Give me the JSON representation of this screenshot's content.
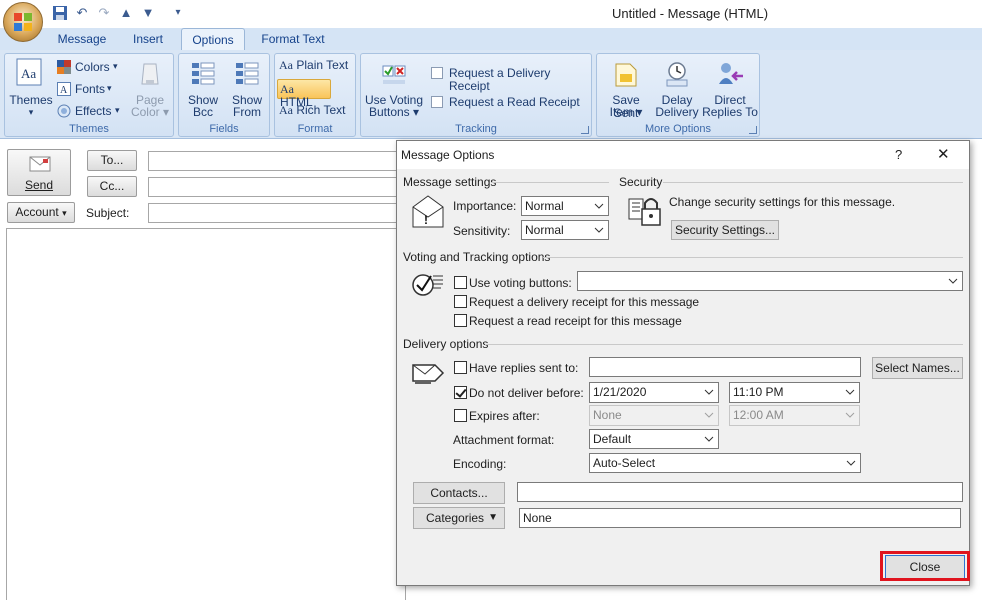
{
  "window": {
    "title": "Untitled - Message (HTML)"
  },
  "ribbon": {
    "tabs": [
      {
        "label": "Message"
      },
      {
        "label": "Insert"
      },
      {
        "label": "Options"
      },
      {
        "label": "Format Text"
      }
    ],
    "active_tab": "Options",
    "groups": {
      "themes": {
        "label": "Themes",
        "themes_button": "Themes",
        "colors": "Colors",
        "fonts": "Fonts",
        "effects": "Effects",
        "page_color_line1": "Page",
        "page_color_line2": "Color"
      },
      "fields": {
        "label": "Fields",
        "show_bcc_line1": "Show",
        "show_bcc_line2": "Bcc",
        "show_from_line1": "Show",
        "show_from_line2": "From"
      },
      "format": {
        "label": "Format",
        "plain_text": "Plain Text",
        "html": "HTML",
        "rich_text": "Rich Text"
      },
      "tracking": {
        "label": "Tracking",
        "voting_line1": "Use Voting",
        "voting_line2": "Buttons",
        "delivery_receipt": "Request a Delivery Receipt",
        "read_receipt": "Request a Read Receipt"
      },
      "more_options": {
        "label": "More Options",
        "save_sent_line1": "Save Sent",
        "save_sent_line2": "Item",
        "delay_line1": "Delay",
        "delay_line2": "Delivery",
        "direct_line1": "Direct",
        "direct_line2": "Replies To"
      }
    }
  },
  "compose": {
    "send": "Send",
    "to": "To...",
    "cc": "Cc...",
    "account": "Account",
    "subject_label": "Subject:"
  },
  "dialog": {
    "title": "Message Options",
    "help": "?",
    "close_x": "✕",
    "message_settings": {
      "heading": "Message settings",
      "importance_label": "Importance:",
      "importance_value": "Normal",
      "sensitivity_label": "Sensitivity:",
      "sensitivity_value": "Normal"
    },
    "security": {
      "heading": "Security",
      "description": "Change security settings for this message.",
      "button": "Security Settings..."
    },
    "voting": {
      "heading": "Voting and Tracking options",
      "use_voting": "Use voting buttons:",
      "use_voting_checked": false,
      "delivery_receipt": "Request a delivery receipt for this message",
      "delivery_receipt_checked": false,
      "read_receipt": "Request a read receipt for this message",
      "read_receipt_checked": false
    },
    "delivery": {
      "heading": "Delivery options",
      "have_replies": "Have replies sent to:",
      "have_replies_checked": false,
      "select_names": "Select Names...",
      "do_not_deliver": "Do not deliver before:",
      "do_not_deliver_checked": true,
      "deliver_date": "1/21/2020",
      "deliver_time": "11:10 PM",
      "expires_after": "Expires after:",
      "expires_checked": false,
      "expires_date": "None",
      "expires_time": "12:00 AM",
      "attachment_format_label": "Attachment format:",
      "attachment_format_value": "Default",
      "encoding_label": "Encoding:",
      "encoding_value": "Auto-Select"
    },
    "contacts_button": "Contacts...",
    "categories_button": "Categories",
    "categories_value": "None",
    "close_button": "Close"
  }
}
